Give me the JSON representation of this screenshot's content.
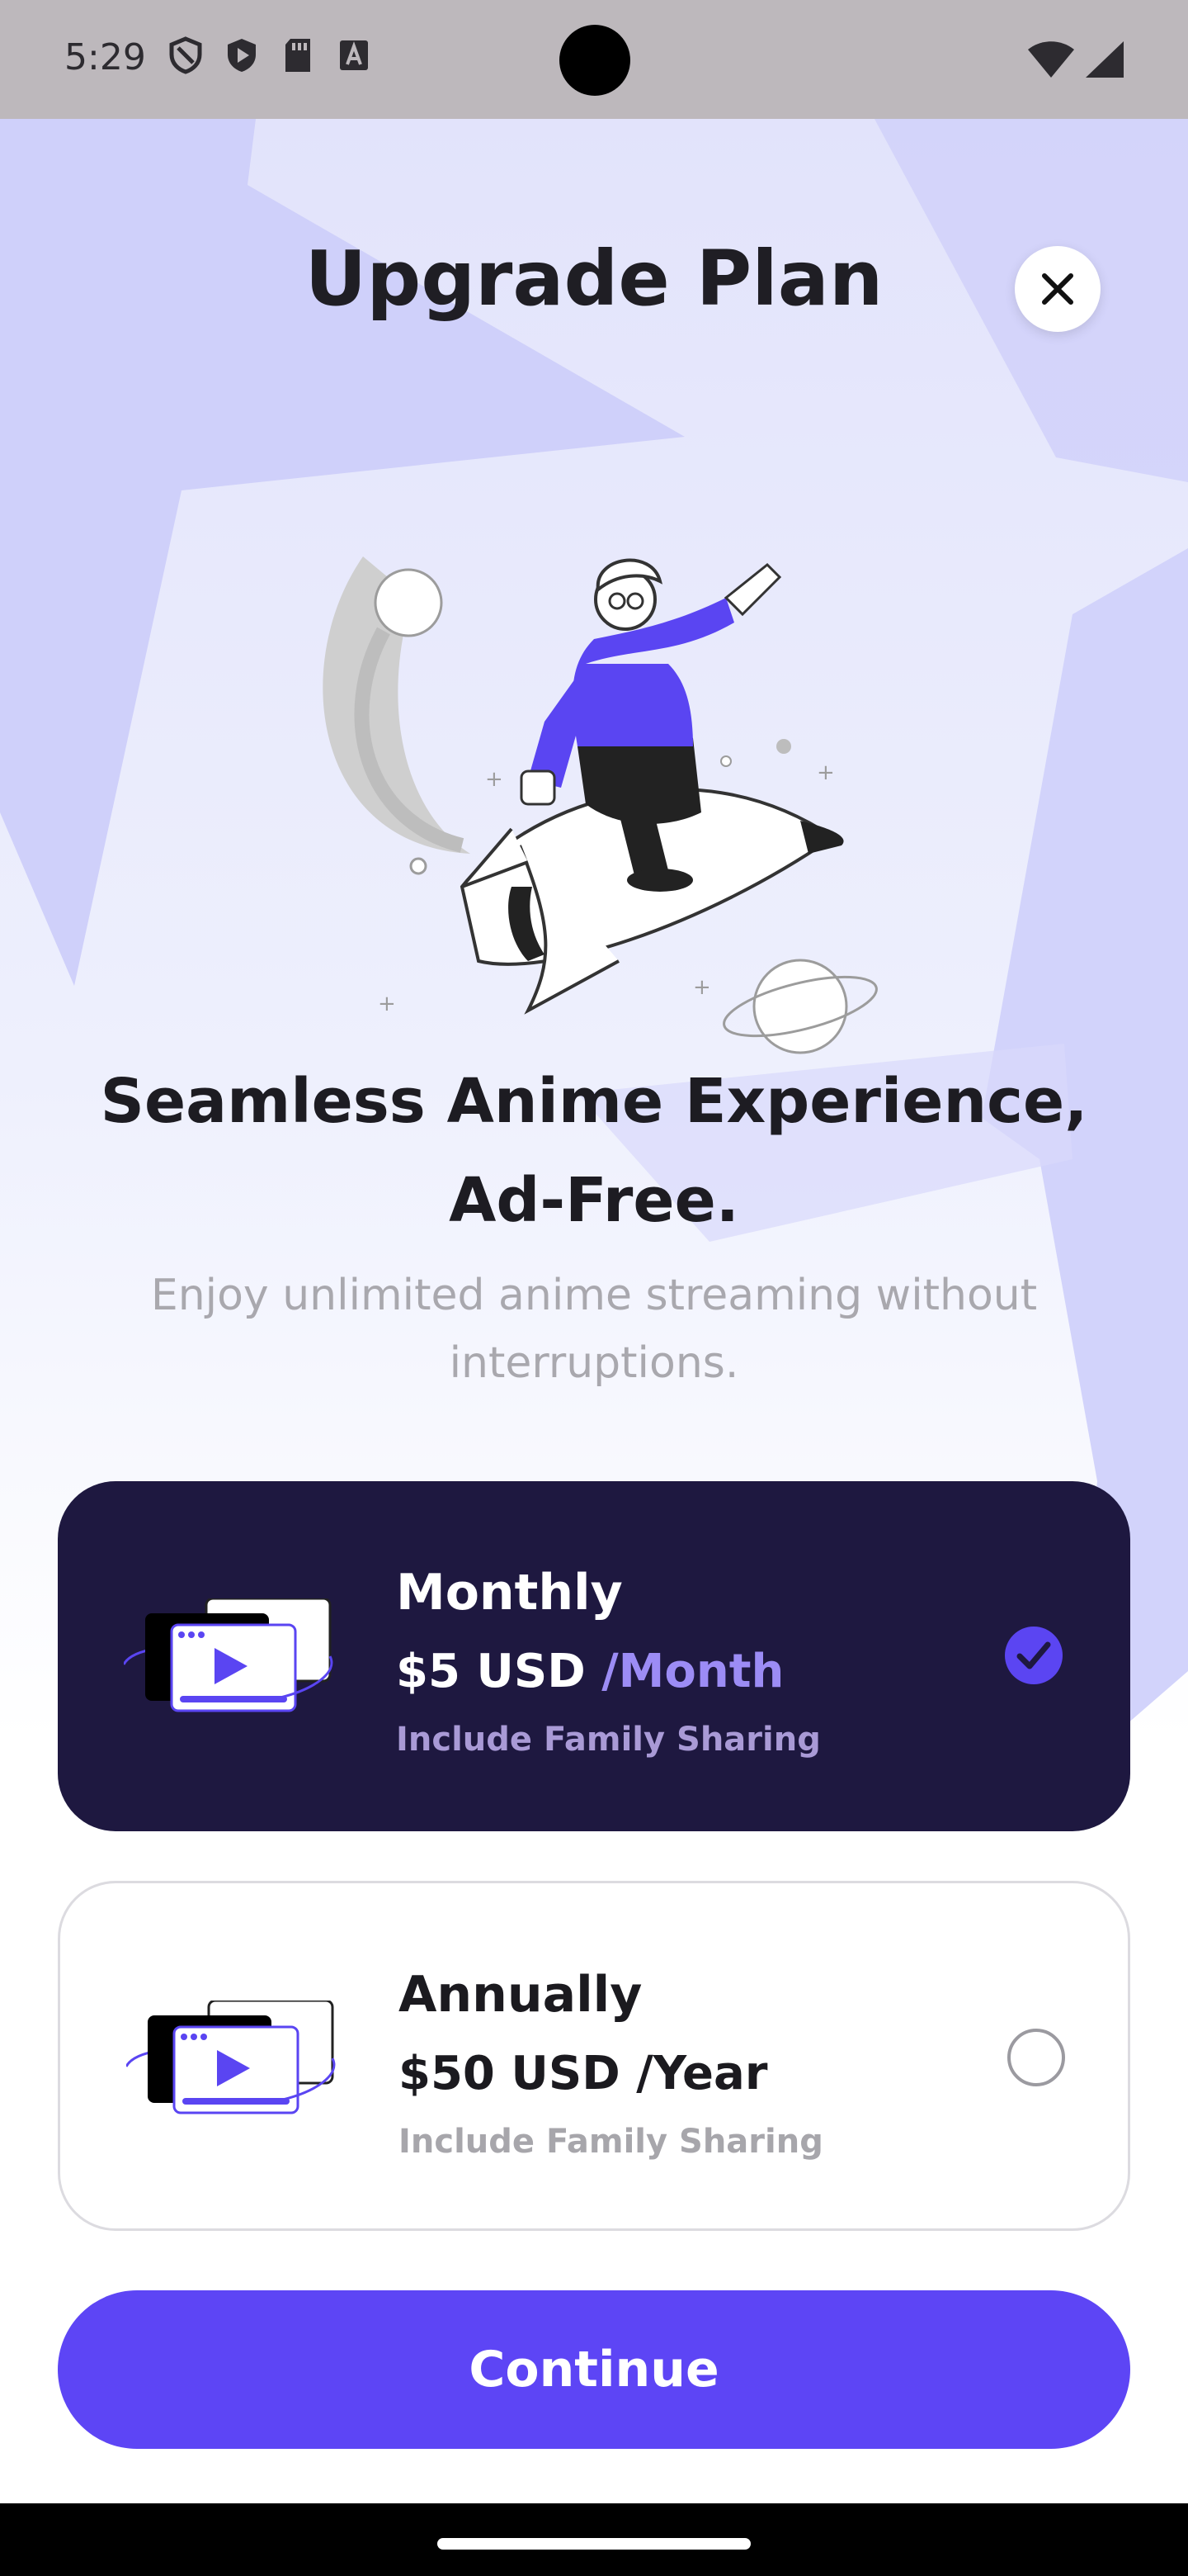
{
  "status_bar": {
    "time": "5:29"
  },
  "header": {
    "title": "Upgrade Plan"
  },
  "hero": {
    "headline": "Seamless Anime Experience, Ad-Free.",
    "subheadline": "Enjoy unlimited anime streaming without interruptions."
  },
  "plans": [
    {
      "name": "Monthly",
      "price": "$5 USD",
      "period": "/Month",
      "note": "Include Family Sharing",
      "selected": true
    },
    {
      "name": "Annually",
      "price": "$50 USD",
      "period": "/Year",
      "note": "Include Family Sharing",
      "selected": false
    }
  ],
  "cta": {
    "label": "Continue"
  },
  "icons": [
    "shield-icon",
    "play-protect-icon",
    "sd-card-icon",
    "font-icon",
    "wifi-icon",
    "signal-icon",
    "close-icon",
    "checkmark-icon",
    "video-player-icon"
  ],
  "colors": {
    "accent": "#5d45f5",
    "selected_card": "#1e1840",
    "bg_shape": "#cfd0fa"
  }
}
